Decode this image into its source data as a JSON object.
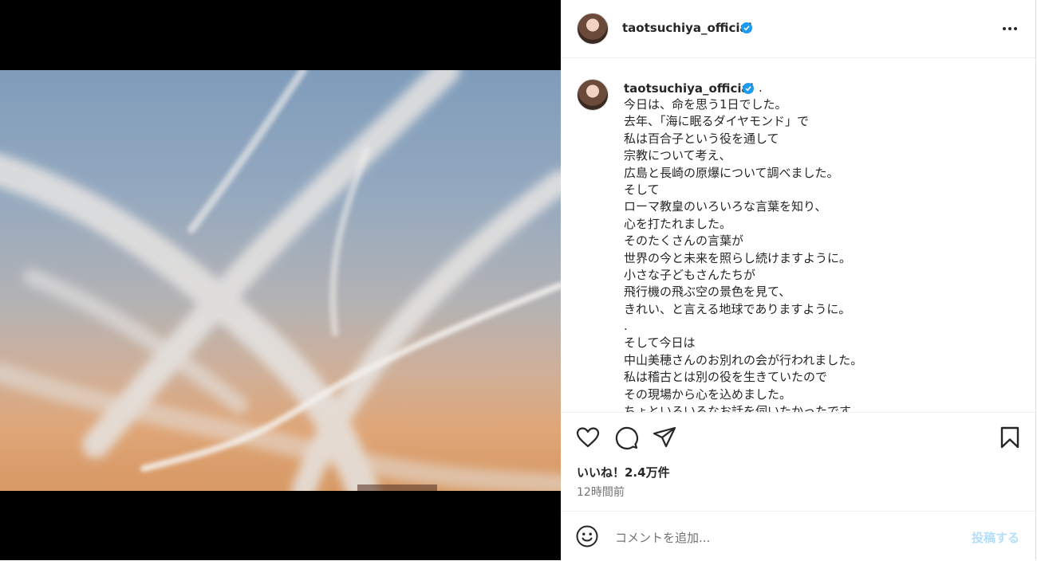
{
  "post": {
    "username": "taotsuchiya_official",
    "media_alt": "sky-with-contrails-photo",
    "caption_suffix": ".",
    "caption_lines": [
      "今日は、命を思う1日でした。",
      "去年、「海に眠るダイヤモンド」で",
      "私は百合子という役を通して",
      "宗教について考え、",
      "広島と長崎の原爆について調べました。",
      "そして",
      "ローマ教皇のいろいろな言葉を知り、",
      "心を打たれました。",
      "そのたくさんの言葉が",
      "世界の今と未来を照らし続けますように。",
      "小さな子どもさんたちが",
      "飛行機の飛ぶ空の景色を見て、",
      "きれい、と言える地球でありますように。",
      ".",
      "そして今日は",
      "中山美穂さんのお別れの会が行われました。",
      "私は稽古とは別の役を生きていたので",
      "その現場から心を込めました。",
      "ちょといろいろなお話を伺いたかったです"
    ],
    "likes": "いいね！2.4万件",
    "time_ago": "12時間前"
  },
  "icons": {
    "verified": "verified-badge-icon",
    "more": "more-options-icon",
    "like": "heart-icon",
    "comment": "comment-icon",
    "share": "paper-plane-icon",
    "save": "bookmark-icon",
    "emoji": "emoji-icon"
  },
  "comment_box": {
    "placeholder": "コメントを追加...",
    "post_label": "投稿する"
  },
  "colors": {
    "verified": "#1d9bf0",
    "post_button_disabled": "#b2dffc",
    "text_secondary": "#737373"
  }
}
